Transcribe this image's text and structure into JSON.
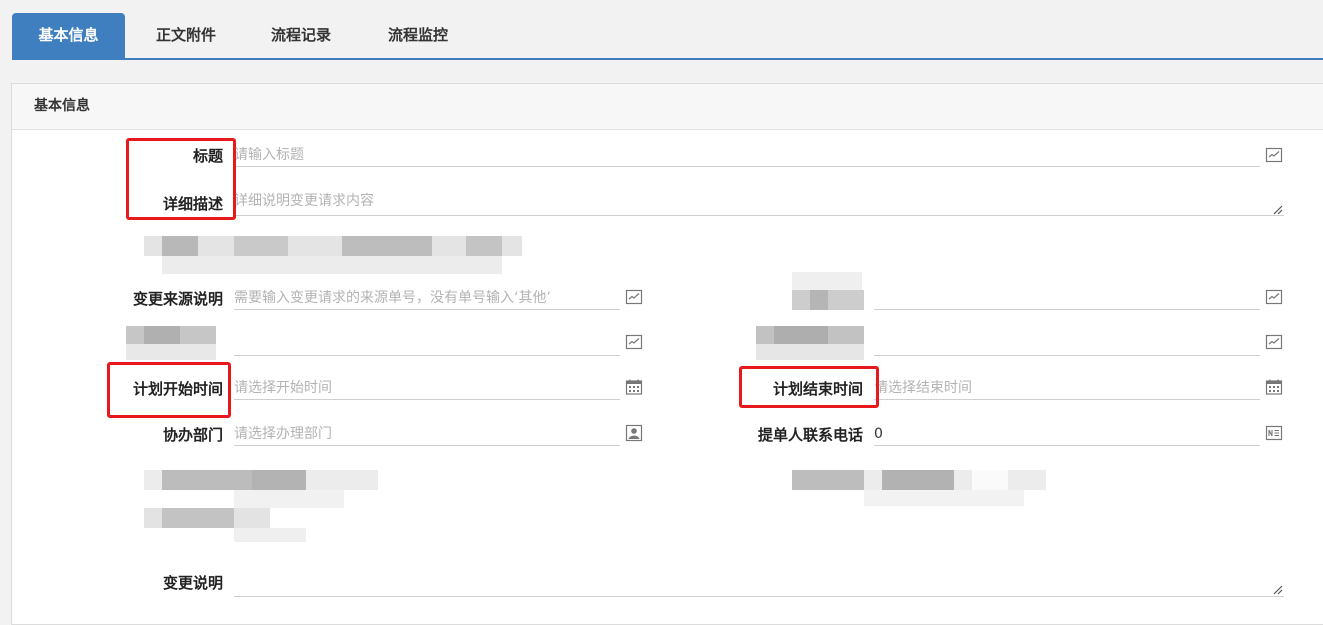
{
  "tabs": [
    {
      "label": "基本信息",
      "active": true
    },
    {
      "label": "正文附件",
      "active": false
    },
    {
      "label": "流程记录",
      "active": false
    },
    {
      "label": "流程监控",
      "active": false
    }
  ],
  "panel": {
    "title": "基本信息"
  },
  "form": {
    "title": {
      "label": "标题",
      "placeholder": "请输入标题",
      "icon": "edit-icon"
    },
    "description": {
      "label": "详细描述",
      "placeholder": "详细说明变更请求内容"
    },
    "source": {
      "label": "变更来源说明",
      "placeholder": "需要输入变更请求的来源单号，没有单号输入‘其他’",
      "icon": "edit-icon"
    },
    "planned_start": {
      "label": "计划开始时间",
      "placeholder": "请选择开始时间",
      "icon": "calendar-icon"
    },
    "planned_end": {
      "label": "计划结束时间",
      "placeholder": "请选择结束时间",
      "icon": "calendar-icon"
    },
    "dept": {
      "label": "协办部门",
      "placeholder": "请选择办理部门",
      "icon": "contact-card-icon"
    },
    "phone": {
      "label": "提单人联系电话",
      "value": "0",
      "icon": "id-card-icon"
    },
    "change_note": {
      "label": "变更说明"
    }
  },
  "colors": {
    "accent": "#3f7fc0",
    "highlight": "#e8191c"
  }
}
